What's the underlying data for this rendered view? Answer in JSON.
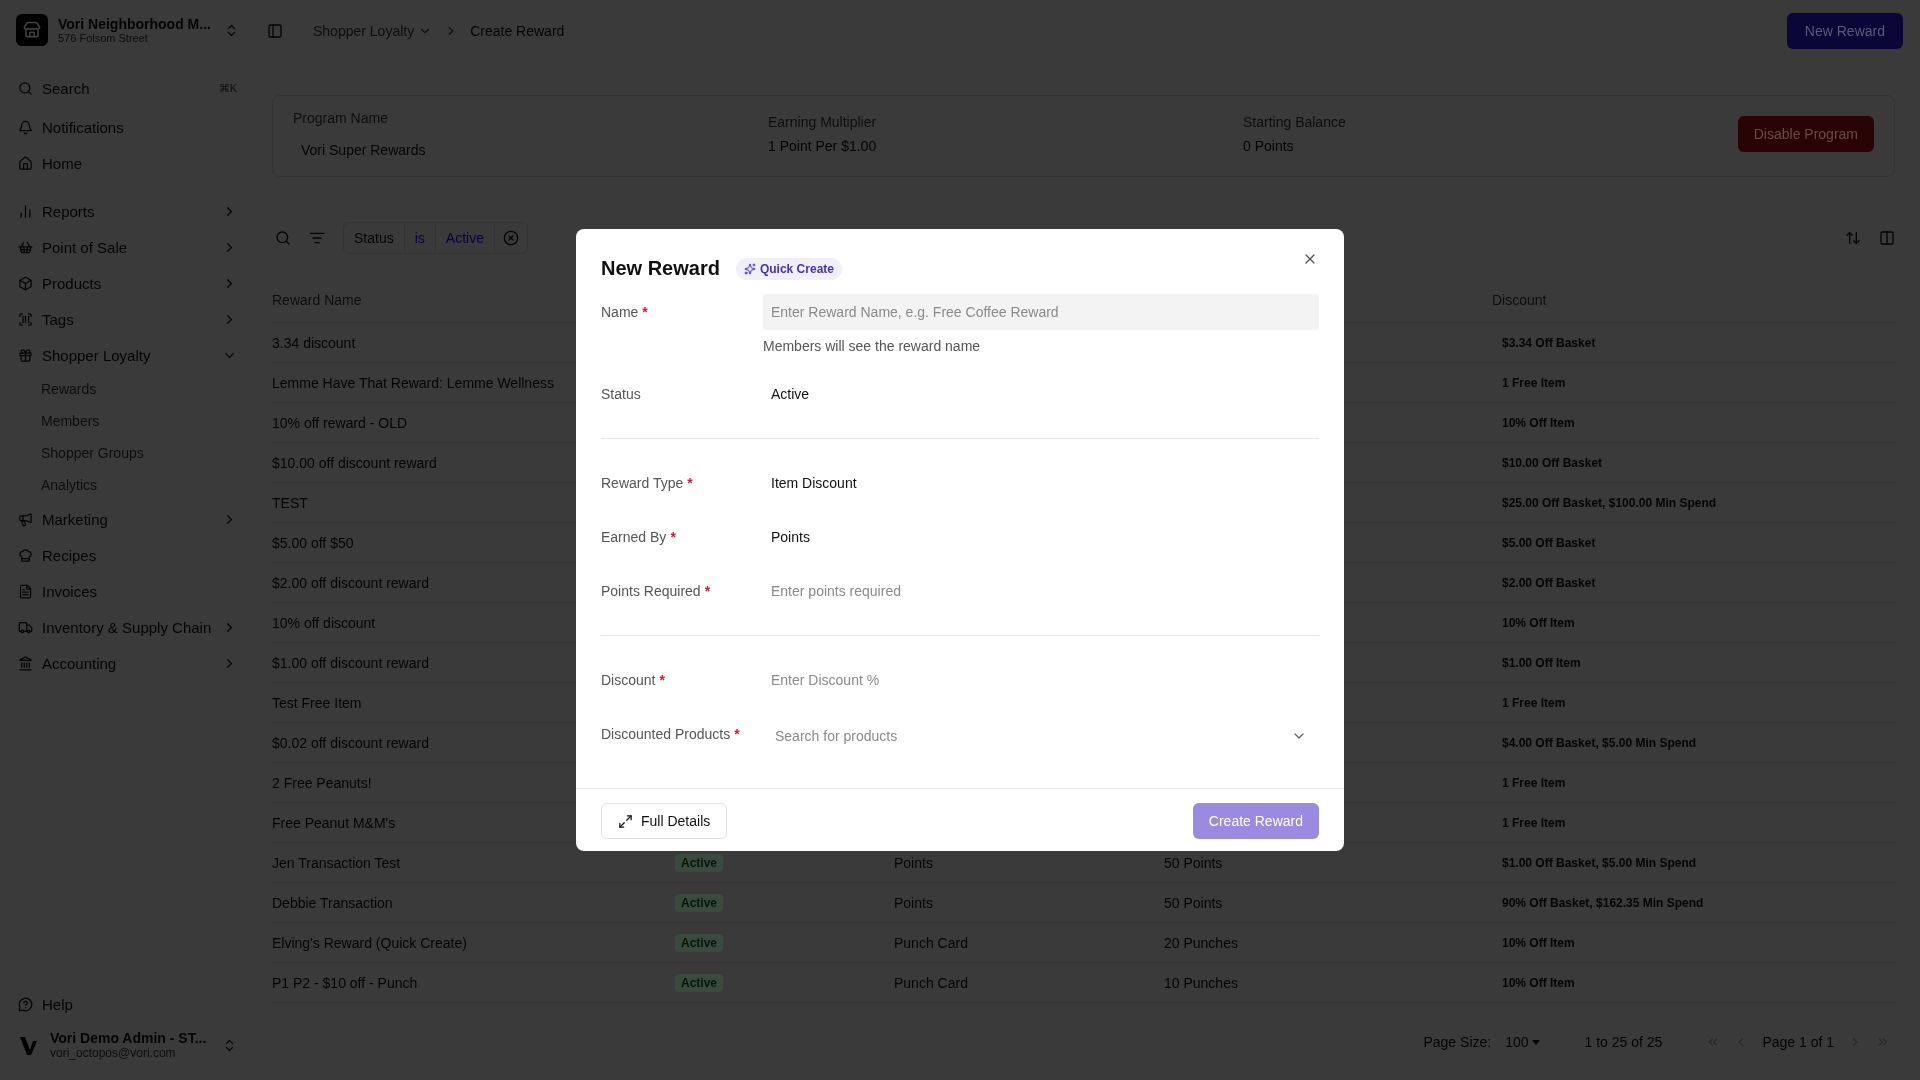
{
  "workspace": {
    "name": "Vori Neighborhood M...",
    "address": "576 Folsom Street"
  },
  "nav": [
    {
      "label": "Search",
      "kind": "search",
      "shortcut": "⌘K"
    },
    {
      "label": "Notifications",
      "kind": "link"
    },
    {
      "label": "Home",
      "kind": "link"
    },
    {
      "label": "Reports",
      "kind": "group",
      "expanded": false
    },
    {
      "label": "Point of Sale",
      "kind": "group",
      "expanded": false
    },
    {
      "label": "Products",
      "kind": "group",
      "expanded": false
    },
    {
      "label": "Tags",
      "kind": "group",
      "expanded": false
    },
    {
      "label": "Shopper Loyalty",
      "kind": "group",
      "expanded": true,
      "children": [
        {
          "label": "Rewards"
        },
        {
          "label": "Members"
        },
        {
          "label": "Shopper Groups"
        },
        {
          "label": "Analytics"
        }
      ]
    },
    {
      "label": "Marketing",
      "kind": "group",
      "expanded": false
    },
    {
      "label": "Recipes",
      "kind": "link"
    },
    {
      "label": "Invoices",
      "kind": "link"
    },
    {
      "label": "Inventory & Supply Chain",
      "kind": "group",
      "expanded": false
    },
    {
      "label": "Accounting",
      "kind": "group",
      "expanded": false
    }
  ],
  "help": "Help",
  "user": {
    "name": "Vori Demo Admin - ST...",
    "email": "vori_octopos@vori.com"
  },
  "breadcrumb": [
    "Shopper Loyalty",
    "Create Reward"
  ],
  "new_reward_button": "New Reward",
  "program": [
    {
      "label": "Program Name",
      "value": "Vori Super Rewards"
    },
    {
      "label": "Earning Multiplier",
      "value": "1 Point Per $1.00"
    },
    {
      "label": "Starting Balance",
      "value": "0 Points"
    }
  ],
  "disable_button": "Disable Program",
  "filter": {
    "field": "Status",
    "operator": "is",
    "value": "Active"
  },
  "table": {
    "header": {
      "name": "Reward Name",
      "discount": "Discount"
    },
    "rows": [
      {
        "name": "3.34 discount",
        "discount": "$3.34 Off Basket"
      },
      {
        "name": "Lemme Have That Reward: Lemme Wellness",
        "discount": "1 Free Item"
      },
      {
        "name": "10% off reward - OLD",
        "discount": "10% Off Item"
      },
      {
        "name": "$10.00 off discount reward",
        "discount": "$10.00 Off Basket"
      },
      {
        "name": "TEST",
        "discount": "$25.00 Off Basket, $100.00 Min Spend"
      },
      {
        "name": "$5.00 off $50",
        "discount": "$5.00 Off Basket"
      },
      {
        "name": "$2.00 off discount reward",
        "discount": "$2.00 Off Basket"
      },
      {
        "name": "10% off discount",
        "discount": "10% Off Item"
      },
      {
        "name": "$1.00 off discount reward",
        "discount": "$1.00 Off Item"
      },
      {
        "name": "Test Free Item",
        "discount": "1 Free Item"
      },
      {
        "name": "$0.02 off discount reward",
        "discount": "$4.00 Off Basket, $5.00 Min Spend"
      },
      {
        "name": "2 Free Peanuts!",
        "discount": "1 Free Item"
      },
      {
        "name": "Free Peanut M&M's",
        "discount": "1 Free Item"
      },
      {
        "name": "Jen Transaction Test",
        "status": "Active",
        "earned_by": "Points",
        "required": "50 Points",
        "discount": "$1.00 Off Basket, $5.00 Min Spend"
      },
      {
        "name": "Debbie Transaction",
        "status": "Active",
        "earned_by": "Points",
        "required": "50 Points",
        "discount": "90% Off Basket, $162.35 Min Spend"
      },
      {
        "name": "Elving's Reward (Quick Create)",
        "status": "Active",
        "earned_by": "Punch Card",
        "required": "20 Punches",
        "discount": "10% Off Item"
      },
      {
        "name": "P1 P2 - $10 off - Punch",
        "status": "Active",
        "earned_by": "Punch Card",
        "required": "10 Punches",
        "discount": "10% Off Item"
      }
    ]
  },
  "pagination": {
    "page_size_label": "Page Size:",
    "page_size": "100",
    "range": "1 to 25 of 25",
    "page": "Page 1 of 1"
  },
  "modal": {
    "title": "New Reward",
    "badge": "Quick Create",
    "sections": [
      [
        {
          "label": "Name",
          "required_mark": "*",
          "kind": "filled-input",
          "placeholder": "Enter Reward Name, e.g. Free Coffee Reward",
          "helper": "Members will see the reward name"
        },
        {
          "label": "Status",
          "kind": "value",
          "value": "Active"
        }
      ],
      [
        {
          "label": "Reward Type",
          "required_mark": "*",
          "kind": "value",
          "value": "Item Discount"
        },
        {
          "label": "Earned By",
          "required_mark": "*",
          "kind": "value",
          "value": "Points"
        },
        {
          "label": "Points Required",
          "required_mark": "*",
          "kind": "plain-input",
          "placeholder": "Enter points required"
        }
      ],
      [
        {
          "label": "Discount",
          "required_mark": "*",
          "kind": "plain-input",
          "placeholder": "Enter Discount %"
        },
        {
          "label": "Discounted Products",
          "required_mark": "*",
          "kind": "select",
          "placeholder": "Search for products"
        }
      ]
    ],
    "full_details_button": "Full Details",
    "create_button": "Create Reward"
  }
}
